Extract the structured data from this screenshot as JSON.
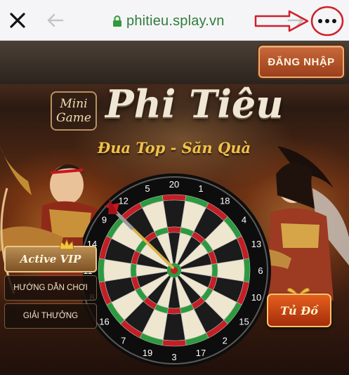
{
  "browser": {
    "url": "phitieu.splay.vn",
    "icons": [
      "close-icon",
      "back-arrow-icon",
      "lock-icon",
      "forward-arrow-icon",
      "more-options-icon"
    ],
    "colors": {
      "url": "#2f7d3a",
      "annotation": "#d0202a"
    }
  },
  "game": {
    "login_label": "ĐĂNG NHẬP",
    "minigame_line1": "Mini",
    "minigame_line2": "Game",
    "title": "Phi Tiêu",
    "subtitle": "Đua Top - Săn Quà",
    "menu": {
      "vip": "Active VIP",
      "guide": "HƯỚNG DẪN CHƠI",
      "prizes": "GIẢI THƯỞNG"
    },
    "tudo_label": "Tủ Đồ",
    "dartboard_numbers": [
      "20",
      "1",
      "18",
      "4",
      "13",
      "6",
      "10",
      "15",
      "2",
      "17",
      "3",
      "19",
      "7",
      "16",
      "8",
      "11",
      "14",
      "9",
      "12",
      "5"
    ]
  }
}
